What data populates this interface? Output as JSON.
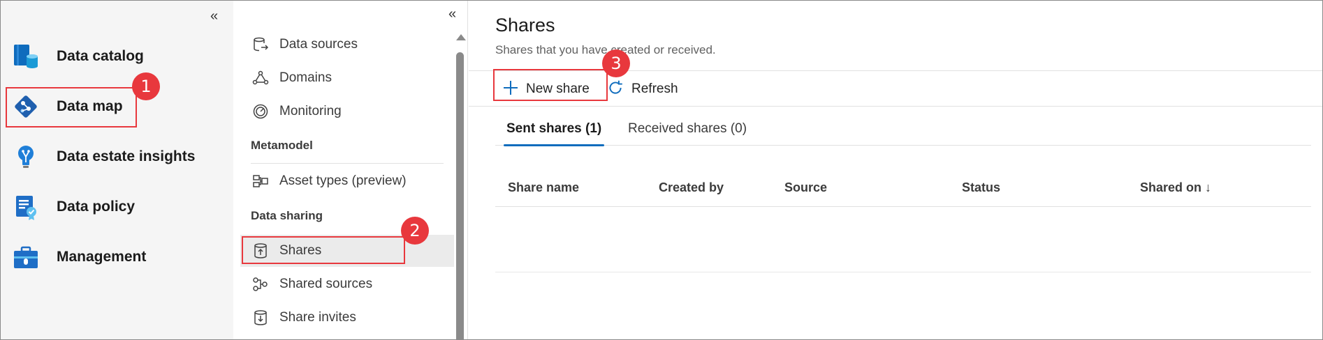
{
  "rail": {
    "collapse_glyph": "«",
    "items": [
      {
        "label": "Data catalog",
        "icon": "data-catalog-icon"
      },
      {
        "label": "Data map",
        "icon": "data-map-icon"
      },
      {
        "label": "Data estate insights",
        "icon": "insights-bulb-icon"
      },
      {
        "label": "Data policy",
        "icon": "data-policy-icon"
      },
      {
        "label": "Management",
        "icon": "toolbox-icon"
      }
    ]
  },
  "submenu": {
    "collapse_glyph": "«",
    "items": [
      {
        "label": "Data sources",
        "icon": "database-arrow-icon"
      },
      {
        "label": "Domains",
        "icon": "domains-triangle-icon"
      },
      {
        "label": "Monitoring",
        "icon": "gauge-icon"
      },
      {
        "label": "Asset types (preview)",
        "icon": "asset-types-icon"
      },
      {
        "label": "Shares",
        "icon": "share-upload-icon"
      },
      {
        "label": "Shared sources",
        "icon": "shared-sources-icon"
      },
      {
        "label": "Share invites",
        "icon": "share-invites-icon"
      }
    ],
    "headers": [
      "Metamodel",
      "Data sharing"
    ],
    "selected": "Shares"
  },
  "main": {
    "title": "Shares",
    "subtitle": "Shares that you have created or received.",
    "commands": {
      "new_share": "New share",
      "refresh": "Refresh"
    },
    "tabs": [
      {
        "label": "Sent shares (1)",
        "active": true
      },
      {
        "label": "Received shares (0)",
        "active": false
      }
    ],
    "columns": [
      "Share name",
      "Created by",
      "Source",
      "Status",
      "Shared on ↓"
    ]
  },
  "callouts": [
    "1",
    "2",
    "3"
  ],
  "colors": {
    "accent": "#0f6cbd",
    "callout": "#e8383d"
  }
}
